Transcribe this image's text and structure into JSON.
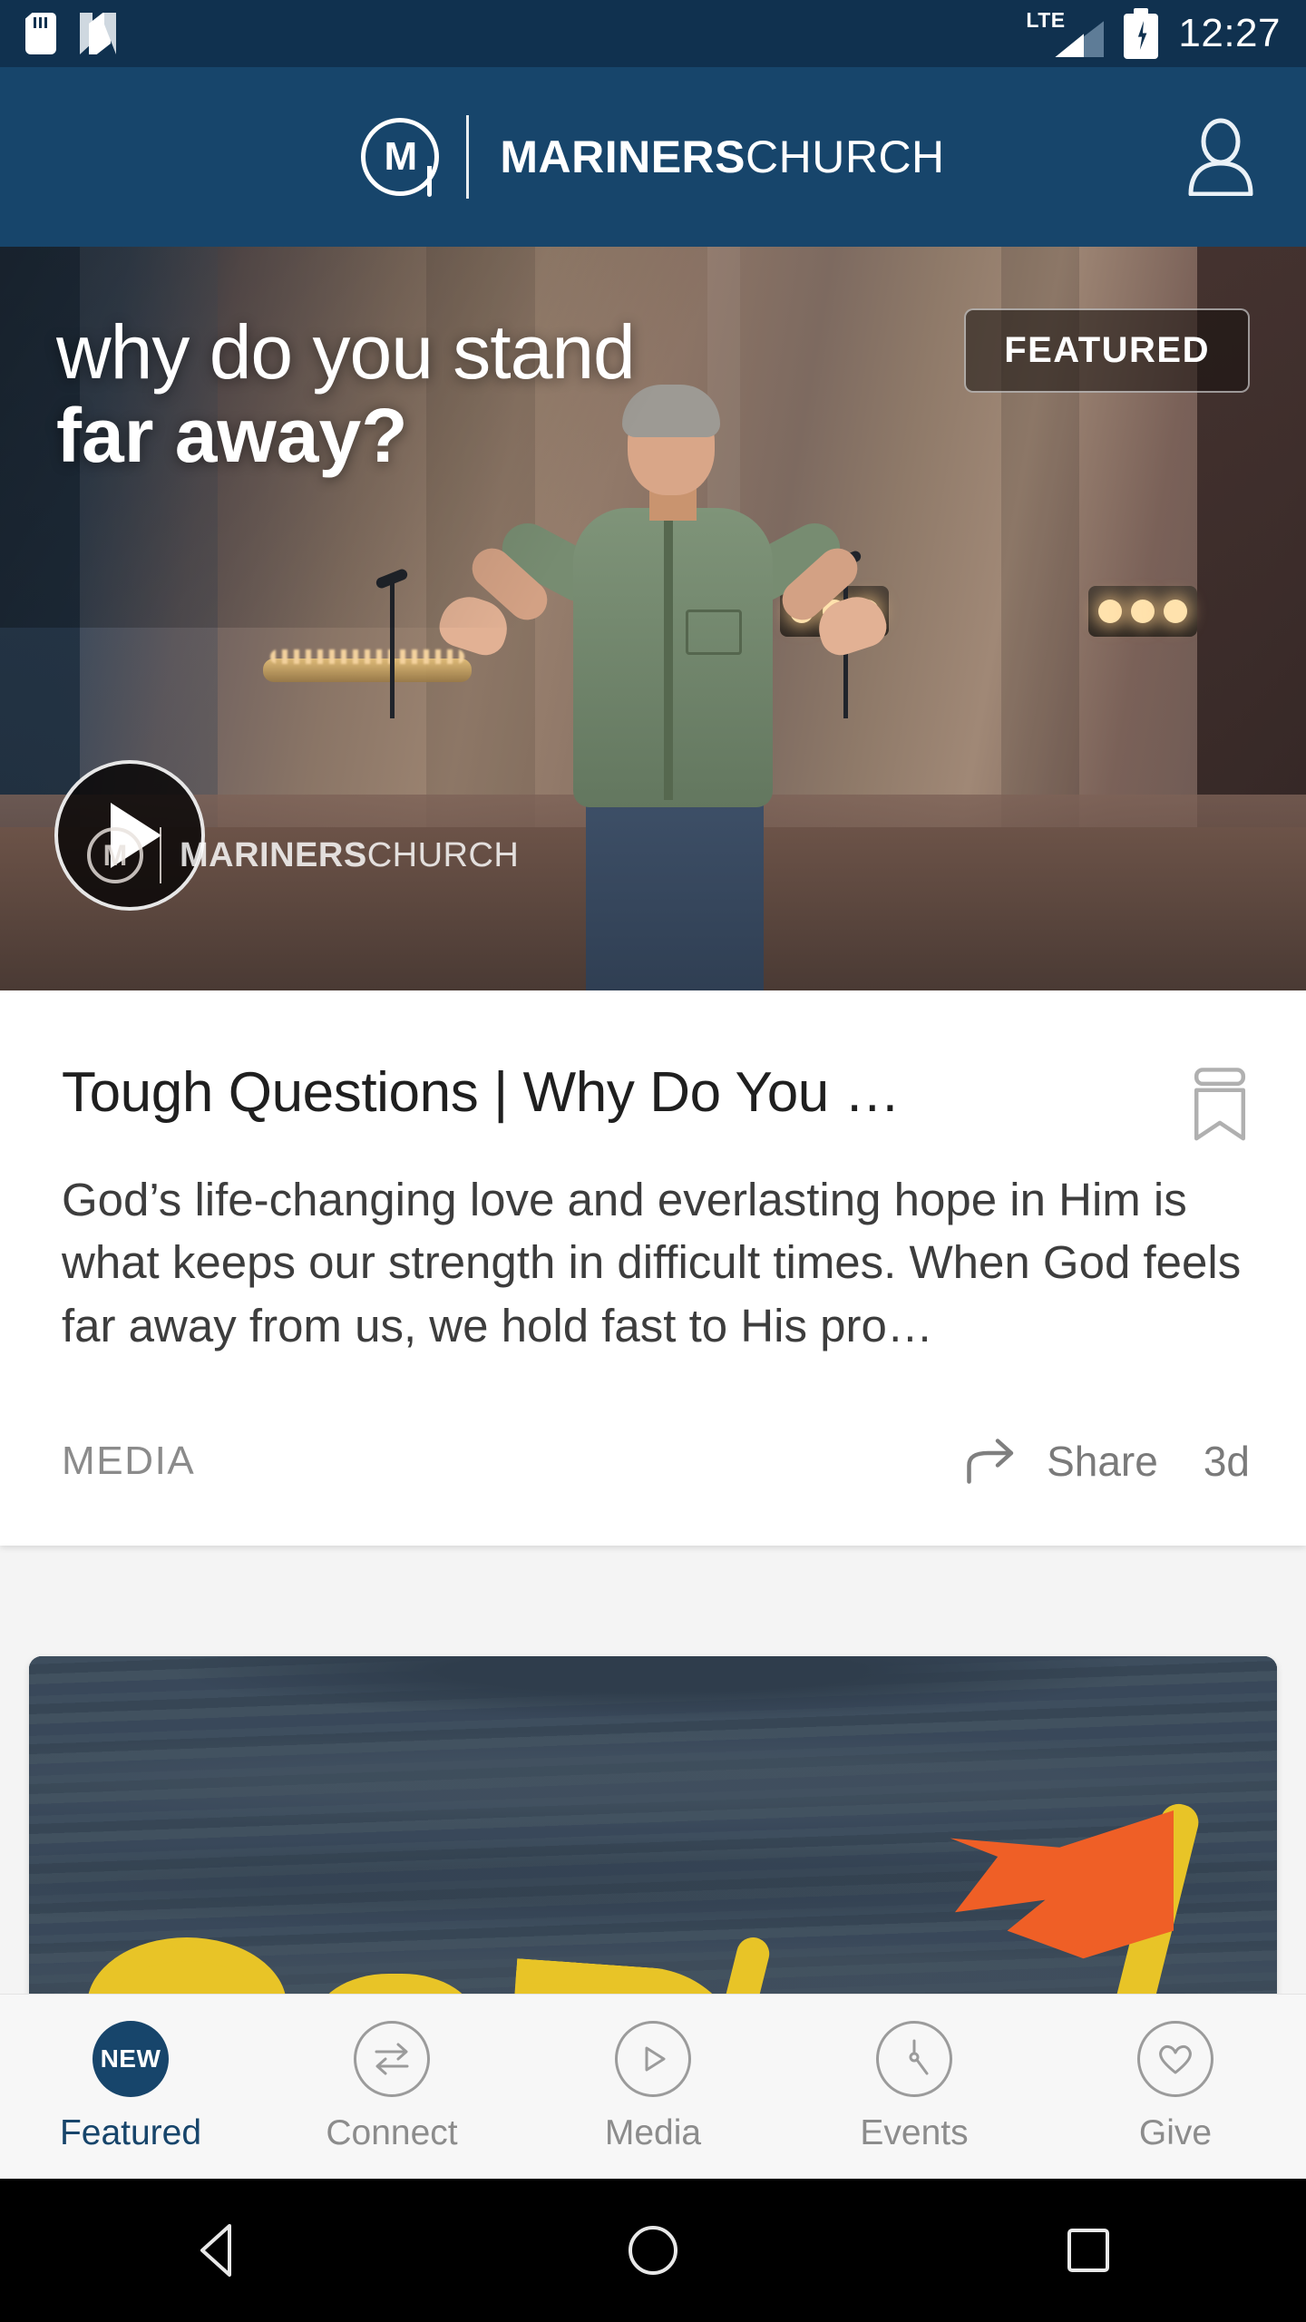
{
  "status_bar": {
    "time": "12:27",
    "network_label": "LTE",
    "icons": [
      "sd-card-icon",
      "nfc-n-icon",
      "lte-signal-icon",
      "battery-charging-icon"
    ],
    "background_color": "#10314f"
  },
  "app_header": {
    "brand_bold": "MARINERS",
    "brand_light": "CHURCH",
    "logo_letter": "M",
    "account_icon": "account-person-icon",
    "background_color": "#17456b"
  },
  "hero": {
    "title_line1": "why do you stand",
    "title_line2": "far away?",
    "badge": "FEATURED",
    "play_icon": "play-icon",
    "watermark_letter": "M",
    "watermark_bold": "MARINERS",
    "watermark_light": "CHURCH"
  },
  "feed": {
    "cards": [
      {
        "title": "Tough Questions | Why Do You …",
        "description": "God’s life-changing love and everlasting hope in Him is what keeps our strength in difficult times. When God feels far away from us, we hold fast to His pro…",
        "category": "MEDIA",
        "share_label": "Share",
        "age": "3d",
        "bookmark_icon": "bookmark-icon",
        "share_icon": "share-arrow-icon"
      },
      {
        "title": "",
        "background_color": "#3b4a5a",
        "accent_color": "#e8c427",
        "flag_color": "#ef5f26"
      }
    ]
  },
  "tab_bar": {
    "active_index": 0,
    "items": [
      {
        "label": "Featured",
        "icon": "new-badge-icon",
        "badge_text": "NEW"
      },
      {
        "label": "Connect",
        "icon": "exchange-arrows-icon"
      },
      {
        "label": "Media",
        "icon": "play-circle-icon"
      },
      {
        "label": "Events",
        "icon": "clock-icon"
      },
      {
        "label": "Give",
        "icon": "heart-icon"
      }
    ],
    "active_color": "#17456b",
    "inactive_color": "#8c8c8c"
  },
  "system_nav": {
    "buttons": [
      {
        "icon": "back-triangle-icon"
      },
      {
        "icon": "home-circle-icon"
      },
      {
        "icon": "recents-square-icon"
      }
    ]
  }
}
